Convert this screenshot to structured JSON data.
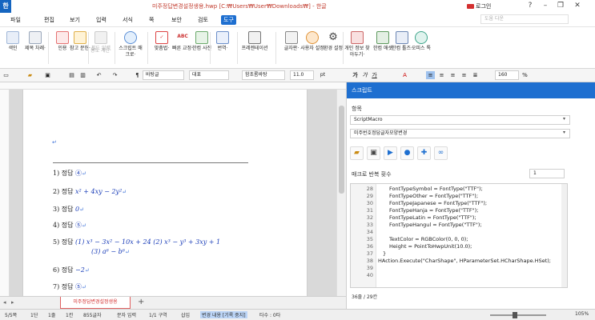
{
  "titlebar": {
    "logo": "한",
    "title": "미주정답변경설정생용.hwp [C:₩Users₩User₩Downloads₩] - 한글",
    "login": "로그인",
    "win_glyphs": [
      "?",
      "–",
      "❐",
      "✕"
    ]
  },
  "menubar": {
    "items": [
      "파일",
      "편집",
      "보기",
      "입력",
      "서식",
      "쪽",
      "보안",
      "검토",
      "도구"
    ],
    "active": "도구",
    "search_placeholder": "도움 다운"
  },
  "ribbon": {
    "buttons": [
      {
        "label": "색인",
        "icon": "index-icon",
        "dim": false
      },
      {
        "label": "제목\n차례·",
        "icon": "toc-icon",
        "dim": false
      },
      {
        "label": "인용",
        "icon": "quote-icon",
        "dim": false
      },
      {
        "label": "참고\n문헌·",
        "icon": "reference-icon",
        "dim": false
      },
      {
        "label": "필드\n입력",
        "icon": "field-icon",
        "dim": false
      },
      {
        "label": "용도\n계산·",
        "icon": "calc-icon",
        "dim": true
      },
      {
        "label": "스크립트\n매크로·",
        "icon": "script-macro-icon",
        "dim": false
      },
      {
        "label": "맞춤법·",
        "icon": "spellcheck-icon",
        "dim": false
      },
      {
        "label": "빠른\n교정·",
        "icon": "quick-correct-icon",
        "dim": false
      },
      {
        "label": "한컴\n사전",
        "icon": "dictionary-icon",
        "dim": false
      },
      {
        "label": "번역·",
        "icon": "translate-icon",
        "dim": false
      },
      {
        "label": "프레젠테이션",
        "icon": "presentation-icon",
        "dim": false
      },
      {
        "label": "글자판·",
        "icon": "keyboard-icon",
        "dim": false
      },
      {
        "label": "사용자\n설정",
        "icon": "user-settings-icon",
        "dim": false
      },
      {
        "label": "환경\n설정",
        "icon": "gear-icon",
        "dim": false
      },
      {
        "label": "개인 정보\n찾아두기·",
        "icon": "privacy-icon",
        "dim": false
      },
      {
        "label": "한컴\n애셋",
        "icon": "asset-icon",
        "dim": false
      },
      {
        "label": "한컴\n툴즈·",
        "icon": "tools-icon",
        "dim": false
      },
      {
        "label": "오피스\n톡",
        "icon": "office-talk-icon",
        "dim": false
      }
    ]
  },
  "format_bar": {
    "style": "바탕글",
    "lang": "대표",
    "font": "함초롬바탕",
    "size": "11.0",
    "size_unit": "pt",
    "zoom": "160",
    "zoom_unit": "%",
    "bold": "가",
    "italic": "가",
    "underline": "가"
  },
  "document": {
    "lines": [
      {
        "num": "1)",
        "label": "정답",
        "content": "④",
        "math": false
      },
      {
        "num": "2)",
        "label": "정답",
        "content": "x² + 4xy − 2y²",
        "math": true
      },
      {
        "num": "3)",
        "label": "정답",
        "content": "0",
        "math": true
      },
      {
        "num": "4)",
        "label": "정답",
        "content": "⑤",
        "math": false
      },
      {
        "num": "5)",
        "label": "정답",
        "content": "(1)  x³ − 3x² − 10x + 24      (2)  x³ − y³ + 3xy + 1",
        "math": true
      },
      {
        "num": "",
        "label": "",
        "content": "(3)  a⁶ − b⁶",
        "math": true
      },
      {
        "num": "6)",
        "label": "정답",
        "content": "−2",
        "math": true
      },
      {
        "num": "7)",
        "label": "정답",
        "content": "⑤",
        "math": false
      }
    ],
    "return_mark": "↵",
    "tab_name": "미주정답변경설정생용",
    "add_tab": "+"
  },
  "script_panel": {
    "header": "스크립트",
    "category_label": "항목",
    "category_value": "ScriptMacro",
    "macro_value": "미주번호정답글자모양변경",
    "repeat_label": "매크로 반복 횟수",
    "repeat_value": "1",
    "toolbar_icons": [
      "open-folder-icon",
      "save-icon",
      "run-icon",
      "record-icon",
      "add-icon",
      "link-icon"
    ],
    "code_lines": [
      {
        "n": "28",
        "t": "FontTypeSymbol = FontType(\"TTF\");"
      },
      {
        "n": "29",
        "t": "FontTypeOther = FontType(\"TTF\");"
      },
      {
        "n": "30",
        "t": "FontTypeJapanese = FontType(\"TTF\");"
      },
      {
        "n": "31",
        "t": "FontTypeHanja = FontType(\"TTF\");"
      },
      {
        "n": "32",
        "t": "FontTypeLatin = FontType(\"TTF\");"
      },
      {
        "n": "33",
        "t": "FontTypeHangul = FontType(\"TTF\");"
      },
      {
        "n": "34",
        "t": ""
      },
      {
        "n": "35",
        "t": "TextColor = RGBColor(0, 0, 0);"
      },
      {
        "n": "36",
        "t": "Height = PointToHwpUnit(10.0);"
      },
      {
        "n": "37",
        "t": "}"
      },
      {
        "n": "38",
        "t": "HAction.Execute(\"CharShape\", HParameterSet.HCharShape.HSet);"
      },
      {
        "n": "39",
        "t": ""
      },
      {
        "n": "40",
        "t": ""
      }
    ],
    "status": "36줄 / 29칸"
  },
  "statusbar": {
    "items": [
      "5/5쪽",
      "1단",
      "1줄",
      "1칸",
      "855글자",
      "문자 입력",
      "1/1 구역",
      "삽입",
      "변경 내용 [기록 중지]",
      "타수 : 0타"
    ],
    "highlighted": "변경 내용 [기록 중지]",
    "zoom": "105%"
  },
  "colors": {
    "accent": "#1e6fd0",
    "title_red": "#c0392b",
    "math_blue": "#1a3db8"
  }
}
